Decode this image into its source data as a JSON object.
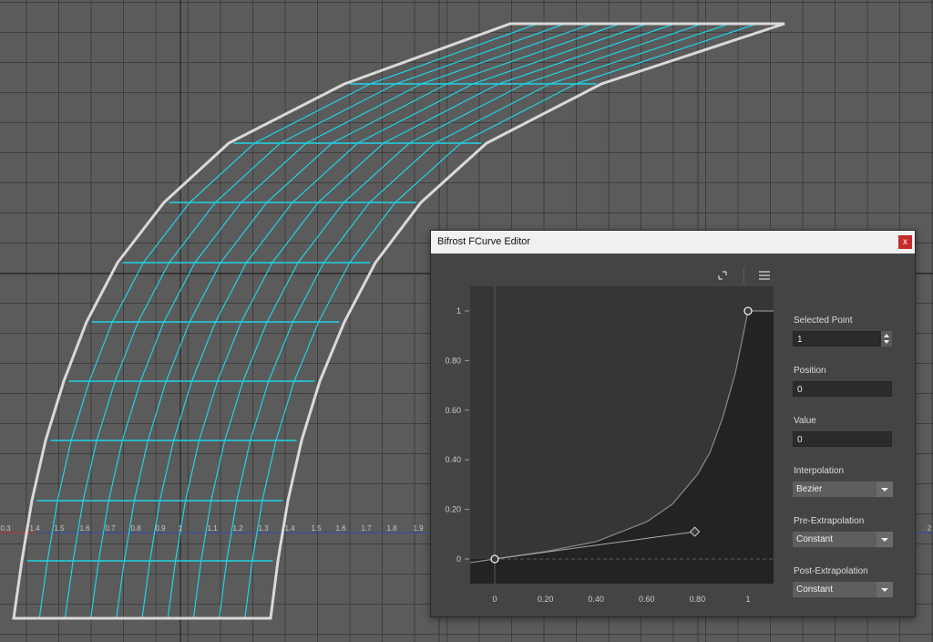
{
  "viewport": {
    "ruler_labels": [
      "0.3",
      "1.4",
      "1.5",
      "1.6",
      "0.7",
      "0.8",
      "0.9",
      "1",
      "1.1",
      "1.2",
      "1.3",
      "1.4",
      "1.5",
      "1.6",
      "1.7",
      "1.8",
      "1.9",
      "2"
    ]
  },
  "dialog": {
    "title": "Bifrost FCurve Editor",
    "close_label": "x",
    "properties": {
      "selected_point_label": "Selected Point",
      "selected_point_value": "1",
      "position_label": "Position",
      "position_value": "0",
      "value_label": "Value",
      "value_value": "0",
      "interpolation_label": "Interpolation",
      "interpolation_value": "Bezier",
      "pre_extrapolation_label": "Pre-Extrapolation",
      "pre_extrapolation_value": "Constant",
      "post_extrapolation_label": "Post-Extrapolation",
      "post_extrapolation_value": "Constant"
    }
  },
  "chart_data": {
    "type": "line",
    "title": "",
    "xlabel": "",
    "ylabel": "",
    "xlim": [
      -0.1,
      1.1
    ],
    "ylim": [
      -0.1,
      1.1
    ],
    "x_ticks": [
      "0",
      "0.20",
      "0.40",
      "0.60",
      "0.80",
      "1"
    ],
    "y_ticks": [
      "1",
      "0.80",
      "0.60",
      "0.40",
      "0.20",
      "0"
    ],
    "keyframes": [
      {
        "x": 0,
        "y": 0
      },
      {
        "x": 1,
        "y": 1
      }
    ],
    "tangent_handles": [
      {
        "x": 0.79,
        "y": 0.11
      }
    ],
    "series": [
      {
        "values_x": [
          0,
          0.2,
          0.4,
          0.6,
          0.7,
          0.8,
          0.85,
          0.9,
          0.95,
          1.0
        ],
        "values_y": [
          0,
          0.03,
          0.07,
          0.15,
          0.22,
          0.34,
          0.43,
          0.57,
          0.75,
          1.0
        ]
      }
    ]
  }
}
